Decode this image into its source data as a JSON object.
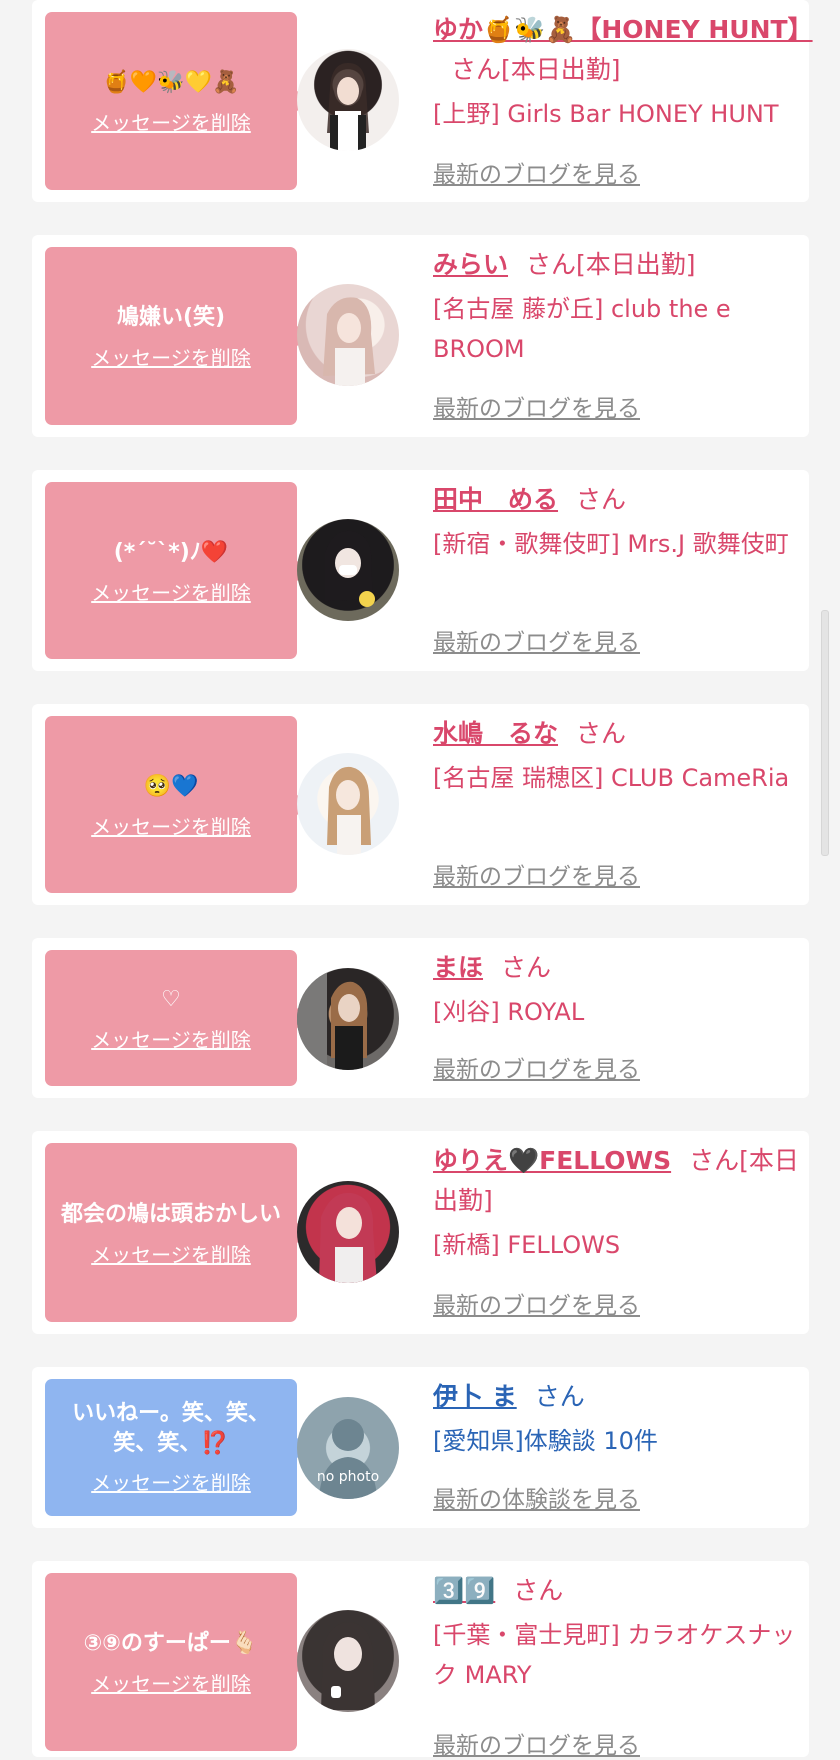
{
  "delete_label": "メッセージを削除",
  "blog_label": "最新のブログを見る",
  "review_label": "最新の体験談を見る",
  "san": "さん",
  "items": [
    {
      "message": "🍯🧡🐝💛🧸",
      "name": "ゆか🍯🐝🧸【HONEY HUNT】",
      "status": "さん[本日出勤]",
      "shop": "[上野] Girls Bar HONEY HUNT",
      "link": "最新のブログを見る"
    },
    {
      "message": "鳩嫌い(笑)",
      "name": "みらい",
      "status": "さん[本日出勤]",
      "shop": "[名古屋 藤が丘] club the e BROOM",
      "link": "最新のブログを見る"
    },
    {
      "message": "(*´˘`*)ﾉ❤️",
      "name": "田中　める",
      "status": "さん",
      "shop": "[新宿・歌舞伎町] Mrs.J 歌舞伎町",
      "link": "最新のブログを見る"
    },
    {
      "message": "🥺💙",
      "name": "水嶋　るな",
      "status": "さん",
      "shop": "[名古屋 瑞穂区] CLUB CameRia",
      "link": "最新のブログを見る"
    },
    {
      "message": "♡",
      "name": "まほ",
      "status": "さん",
      "shop": "[刈谷] ROYAL",
      "link": "最新のブログを見る"
    },
    {
      "message": "都会の鳩は頭おかしい",
      "name": "ゆりえ🖤FELLOWS",
      "status": "さん[本日出勤]",
      "shop": "[新橋] FELLOWS",
      "link": "最新のブログを見る"
    },
    {
      "message": "いいねー。笑、笑、笑、笑、⁉️",
      "name": "伊卜 ま",
      "status": "さん",
      "shop": "[愛知県]体験談 10件",
      "link": "最新の体験談を見る",
      "no_photo": "no photo"
    },
    {
      "message": "③⑨のすーぱー🫰🏻",
      "name": "3️⃣9️⃣",
      "status": "さん",
      "shop": "[千葉・富士見町] カラオケスナック MARY",
      "link": "最新のブログを見る"
    }
  ],
  "colors": {
    "pink_bubble": "#ee9aa6",
    "blue_bubble": "#8fb5f0",
    "pink_text": "#d9476b",
    "blue_text": "#2a64b5",
    "link_gray": "#8c8c8c"
  }
}
